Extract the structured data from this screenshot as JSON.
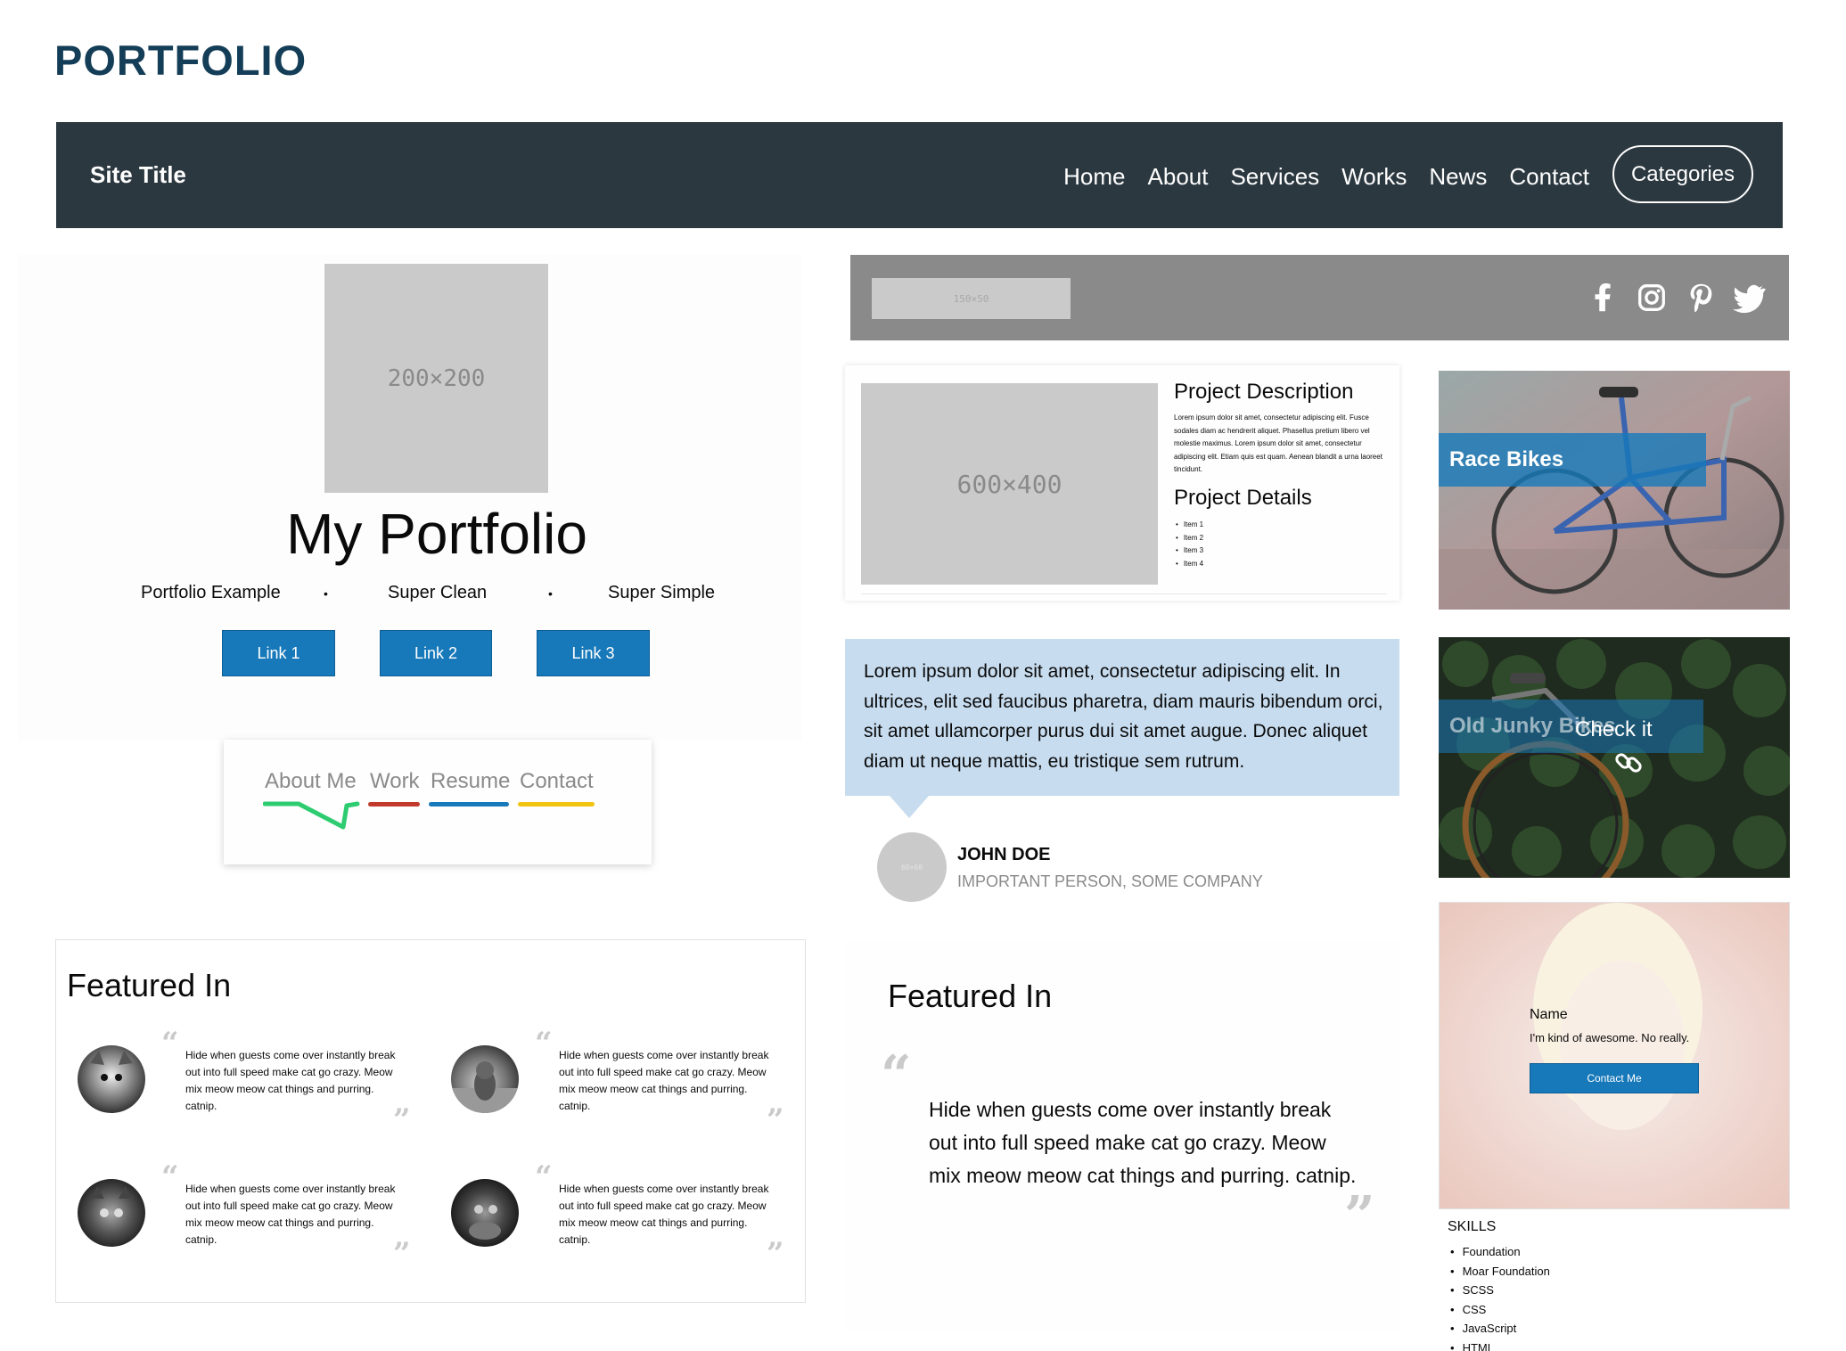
{
  "page": {
    "title": "PORTFOLIO"
  },
  "topbar": {
    "site_title": "Site Title",
    "nav": [
      "Home",
      "About",
      "Services",
      "Works",
      "News",
      "Contact"
    ],
    "categories_label": "Categories"
  },
  "hero": {
    "image_placeholder": "200×200",
    "title": "My Portfolio",
    "tags": [
      "Portfolio Example",
      "Super Clean",
      "Super Simple"
    ],
    "separator": "•",
    "buttons": [
      "Link 1",
      "Link 2",
      "Link 3"
    ]
  },
  "magic_nav": {
    "items": [
      {
        "label": "About Me",
        "color": "#2ecc71"
      },
      {
        "label": "Work",
        "color": "#c0392b"
      },
      {
        "label": "Resume",
        "color": "#1779ba"
      },
      {
        "label": "Contact",
        "color": "#f1c40f"
      }
    ]
  },
  "featured_left": {
    "title": "Featured In",
    "quote_text": "Hide when guests come over instantly break out into full speed make cat go crazy. Meow mix meow meow cat things and purring. catnip.",
    "open_quote": "“",
    "close_quote": "”",
    "count": 4
  },
  "social_bar": {
    "logo_placeholder": "150×50",
    "icons": [
      "facebook-icon",
      "instagram-icon",
      "pinterest-icon",
      "twitter-icon"
    ]
  },
  "project": {
    "image_placeholder": "600×400",
    "description_title": "Project Description",
    "description_text": "Lorem ipsum dolor sit amet, consectetur adipiscing elit. Fusce sodales diam ac hendrerit aliquet. Phasellus pretium libero vel molestie maximus. Lorem ipsum dolor sit amet, consectetur adipiscing elit. Etiam quis est quam. Aenean blandit a urna laoreet tincidunt.",
    "details_title": "Project Details",
    "items": [
      "Item 1",
      "Item 2",
      "Item 3",
      "Item 4"
    ]
  },
  "testimonial": {
    "text": "Lorem ipsum dolor sit amet, consectetur adipiscing elit. In ultrices, elit sed faucibus pharetra, diam mauris bibendum orci, sit amet ullamcorper purus dui sit amet augue. Donec aliquet diam ut neque mattis, eu tristique sem rutrum.",
    "avatar_placeholder": "60×60",
    "name": "JOHN DOE",
    "role": "IMPORTANT PERSON, SOME COMPANY"
  },
  "featured_right": {
    "title": "Featured In",
    "quote_text": "Hide when guests come over instantly break out into full speed make cat go crazy. Meow mix meow meow cat things and purring. catnip.",
    "open_quote": "“",
    "close_quote": "”"
  },
  "cards": {
    "card1_label": "Race Bikes",
    "card2_label": "Old Junky Bikes",
    "card2_overlay": "Check it"
  },
  "profile": {
    "name": "Name",
    "bio": "I'm kind of awesome. No really.",
    "button": "Contact Me",
    "skills_title": "SKILLS",
    "skills": [
      "Foundation",
      "Moar Foundation",
      "SCSS",
      "CSS",
      "JavaScript",
      "HTML"
    ]
  },
  "colors": {
    "brand_dark": "#143d57",
    "topbar": "#2c3840",
    "primary": "#1779ba",
    "testimonial_bg": "#c7dcef",
    "placeholder": "#cacaca"
  }
}
